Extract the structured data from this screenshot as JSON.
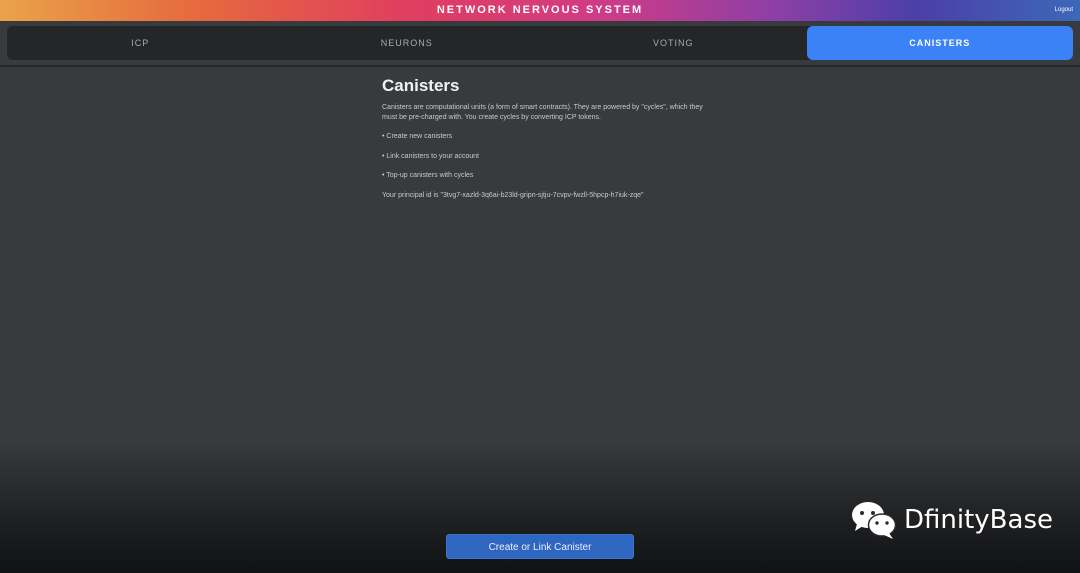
{
  "header": {
    "title": "NETWORK NERVOUS SYSTEM",
    "logout_label": "Logout"
  },
  "tabs": [
    {
      "label": "ICP",
      "active": false
    },
    {
      "label": "NEURONS",
      "active": false
    },
    {
      "label": "VOTING",
      "active": false
    },
    {
      "label": "CANISTERS",
      "active": true
    }
  ],
  "main": {
    "title": "Canisters",
    "description": "Canisters are computational units (a form of smart contracts). They are powered by \"cycles\", which they must be pre-charged with. You create cycles by converting ICP tokens.",
    "bullets": [
      "• Create new canisters",
      "• Link canisters to your account",
      "• Top-up canisters with cycles"
    ],
    "principal": "Your principal id is \"3tvg7-xazld-3q6ai-b23ld-gripn-sjtju-7cvpv-fwzll-5hpcp-h7iuk-zqe\""
  },
  "action": {
    "label": "Create or Link Canister"
  },
  "watermark": {
    "text": "DfinityBase",
    "icon": "wechat-icon"
  },
  "colors": {
    "accent": "#3b82f6",
    "button": "#2f66c0",
    "background": "#383b3d",
    "tab_bar": "#242628"
  }
}
